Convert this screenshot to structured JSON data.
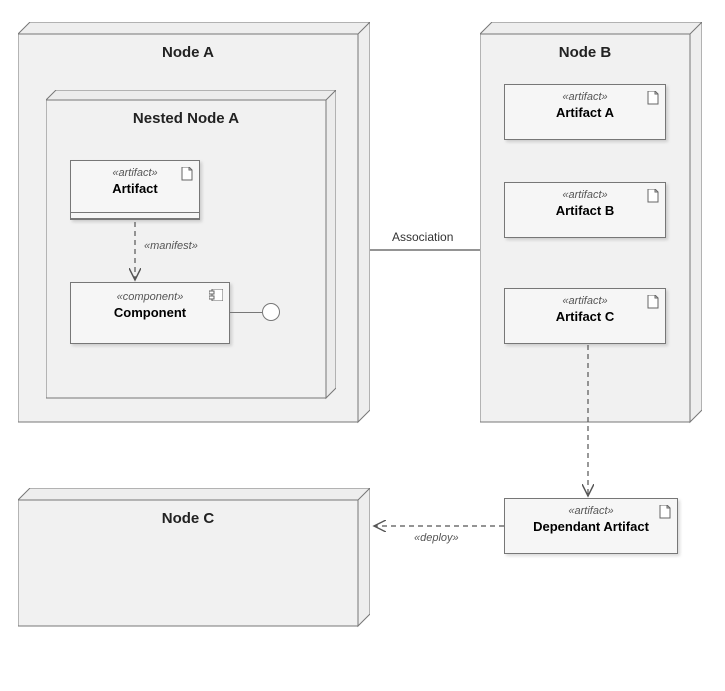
{
  "diagram_type": "UML Deployment Diagram",
  "nodes": {
    "nodeA": {
      "title": "Node A"
    },
    "nestedA": {
      "title": "Nested Node A"
    },
    "nodeB": {
      "title": "Node B"
    },
    "nodeC": {
      "title": "Node C"
    }
  },
  "stereotypes": {
    "artifact": "«artifact»",
    "component": "«component»",
    "manifest": "«manifest»",
    "deploy": "«deploy»"
  },
  "artifacts": {
    "artifact_in_nested": {
      "name": "Artifact"
    },
    "artifactA": {
      "name": "Artifact A"
    },
    "artifactB": {
      "name": "Artifact B"
    },
    "artifactC": {
      "name": "Artifact C"
    },
    "dependant": {
      "name": "Dependant Artifact"
    }
  },
  "component": {
    "name": "Component"
  },
  "relationships": {
    "association": {
      "label": "Association",
      "from": "Node A",
      "to": "Node B"
    },
    "manifest": {
      "label": "«manifest»",
      "from": "Artifact",
      "to": "Component"
    },
    "dependency_c": {
      "from": "Artifact C",
      "to": "Dependant Artifact"
    },
    "deploy": {
      "label": "«deploy»",
      "from": "Dependant Artifact",
      "to": "Node C"
    }
  }
}
